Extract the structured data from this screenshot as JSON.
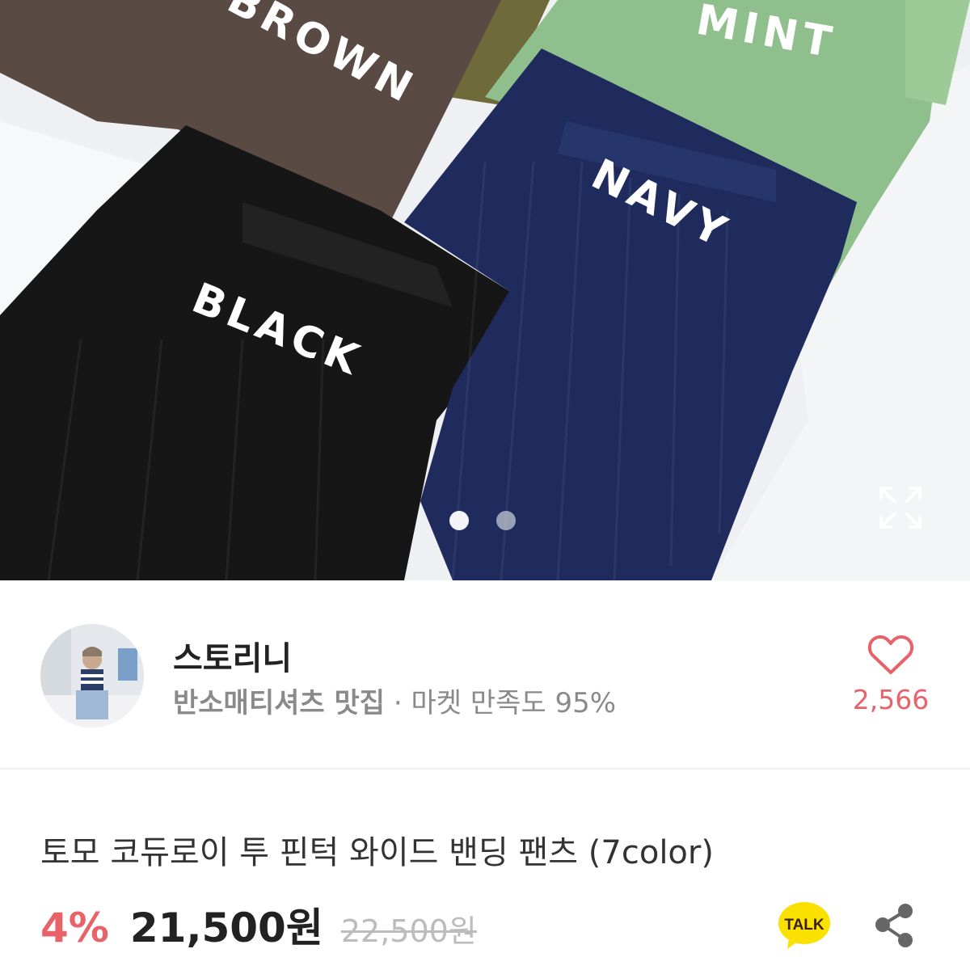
{
  "hero": {
    "pant_labels": [
      "BROWN",
      "MINT",
      "BLACK",
      "NAVY"
    ],
    "carousel_total": 2,
    "carousel_active": 1
  },
  "seller": {
    "name": "스토리니",
    "tagline": "반소매티셔츠 맛집",
    "separator": " · ",
    "satisfaction": "마켓 만족도 95%",
    "likes": "2,566"
  },
  "product": {
    "title": "토모 코듀로이 투 핀턱 와이드 밴딩 팬츠 (7color)",
    "discount": "4%",
    "price": "21,500원",
    "original_price": "22,500원"
  },
  "actions": {
    "talk_label": "TALK"
  },
  "colors": {
    "accent": "#e8626a",
    "brown": "#5a4a44",
    "mint": "#8fbf8c",
    "black": "#161616",
    "navy": "#1e2b5c",
    "kakao_yellow": "#fae100"
  }
}
